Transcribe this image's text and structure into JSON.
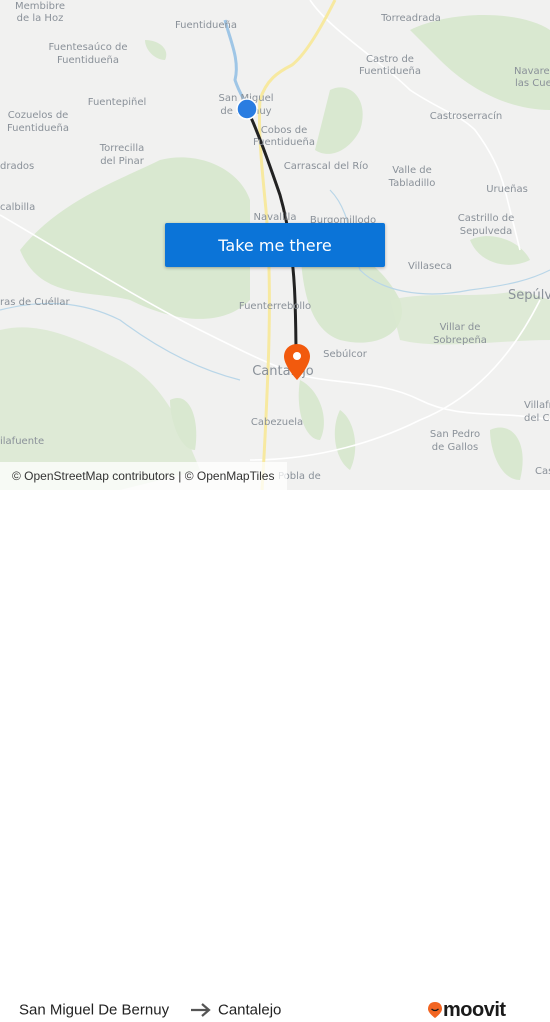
{
  "map": {
    "labels": [
      "Membibre",
      "de la Hoz",
      "Fuentidueña",
      "Fuentesaúco de",
      "Fuentidueña",
      "Fuentepiñel",
      "Cozuelos de",
      "Fuentidueña",
      "Torrecilla",
      "del Pinar",
      "drados",
      "calbilla",
      "San Miguel",
      "de Bernuy",
      "Cobos de",
      "Fuentidueña",
      "Torreadrada",
      "Castro de",
      "Fuentidueña",
      "Navares de",
      "las Cuevas",
      "Castroserracín",
      "Carrascal del Río",
      "Valle de",
      "Tabladillo",
      "Urueñas",
      "Castrillo de",
      "Sepulveda",
      "Navalilla",
      "Burgomillodo",
      "Villaseca",
      "Sepúlveda",
      "ras de Cuéllar",
      "Fuenterrebollo",
      "Villar de",
      "Sobrepeña",
      "Sebúlcor",
      "Cantalejo",
      "Cabezuela",
      "ilafuente",
      "San Pedro",
      "de Gallos",
      "Villafranca",
      "del Condado",
      "Casla",
      "Pobla de"
    ],
    "attribution": "© OpenStreetMap contributors | © OpenMapTiles",
    "origin_marker_color": "#2a7de1",
    "destination_marker_color": "#f25a0d",
    "route_color": "#222222"
  },
  "cta": {
    "label": "Take me there",
    "color": "#0b74d8"
  },
  "footer": {
    "from": "San Miguel De Bernuy",
    "arrow_icon": "arrow-right-icon",
    "to": "Cantalejo",
    "brand": "moovit",
    "brand_color": "#f26522"
  }
}
